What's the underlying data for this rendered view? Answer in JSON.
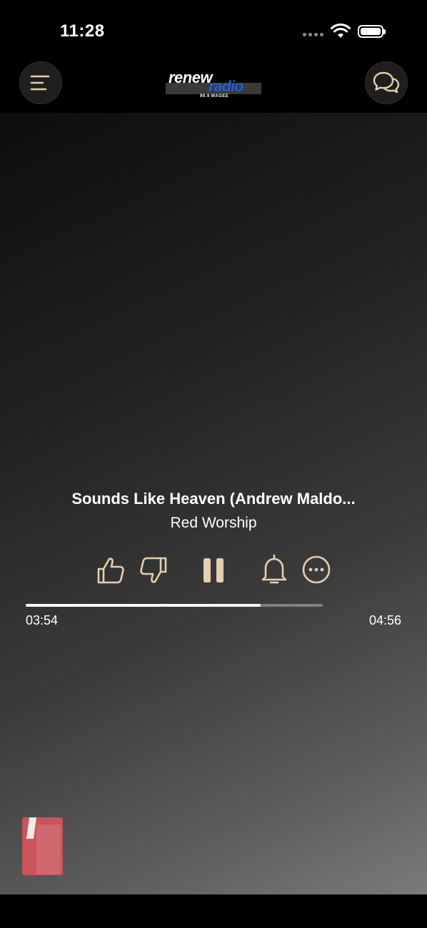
{
  "status_bar": {
    "time": "11:28"
  },
  "header": {
    "logo": {
      "word1": "renew",
      "word2": "radio",
      "subtitle": "96.9 MAGEE"
    },
    "menu_icon": "hamburger-menu-icon",
    "chat_icon": "chat-bubbles-icon"
  },
  "player": {
    "title": "Sounds Like Heaven (Andrew Maldo...",
    "artist": "Red Worship",
    "elapsed": "03:54",
    "total": "04:56",
    "progress_fraction": 0.79,
    "controls": [
      "thumbs-up-icon",
      "thumbs-down-icon",
      "pause-icon",
      "bell-icon",
      "more-icon"
    ]
  },
  "colors": {
    "accent": "#e4cfb0",
    "logo_blue": "#1e5fd6",
    "album_art": "#c9545c"
  }
}
